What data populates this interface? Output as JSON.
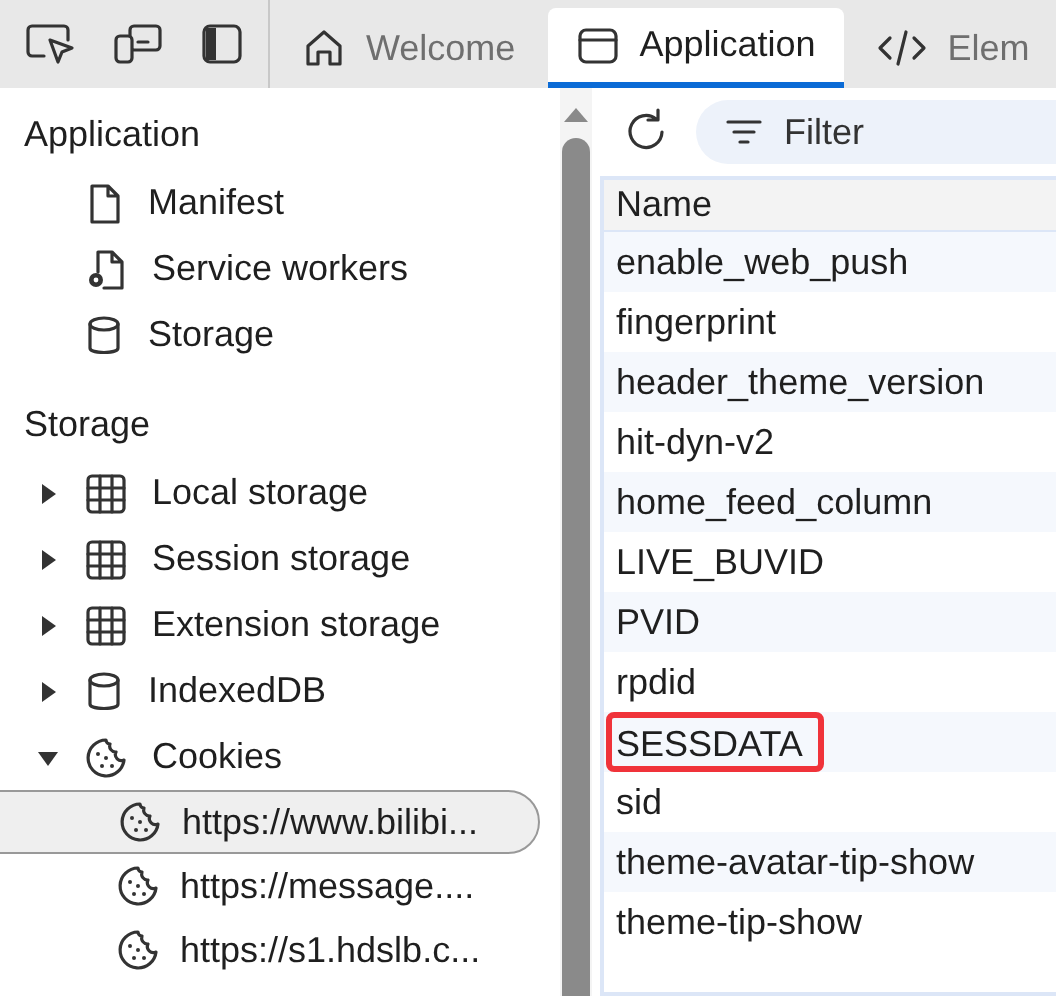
{
  "tabs": [
    {
      "label": "Welcome",
      "kind": "home",
      "selected": false
    },
    {
      "label": "Application",
      "kind": "window",
      "selected": true
    },
    {
      "label": "Elem",
      "kind": "code",
      "selected": false
    }
  ],
  "sidebar": {
    "sections": [
      {
        "title": "Application",
        "items": [
          {
            "label": "Manifest",
            "kind": "file"
          },
          {
            "label": "Service workers",
            "kind": "worker"
          },
          {
            "label": "Storage",
            "kind": "db"
          }
        ]
      },
      {
        "title": "Storage",
        "items": [
          {
            "label": "Local storage",
            "kind": "grid",
            "expanded": false
          },
          {
            "label": "Session storage",
            "kind": "grid",
            "expanded": false
          },
          {
            "label": "Extension storage",
            "kind": "grid",
            "expanded": false
          },
          {
            "label": "IndexedDB",
            "kind": "db",
            "expanded": false
          },
          {
            "label": "Cookies",
            "kind": "cookie",
            "expanded": true,
            "children": [
              {
                "label": "https://www.bilibi...",
                "selected": true
              },
              {
                "label": "https://message....",
                "selected": false
              },
              {
                "label": "https://s1.hdslb.c...",
                "selected": false
              }
            ]
          }
        ]
      }
    ]
  },
  "filter": {
    "placeholder": "Filter"
  },
  "table": {
    "columns": [
      "Name"
    ],
    "rows": [
      {
        "name": "enable_web_push",
        "highlighted": false
      },
      {
        "name": "fingerprint",
        "highlighted": false
      },
      {
        "name": "header_theme_version",
        "highlighted": false
      },
      {
        "name": "hit-dyn-v2",
        "highlighted": false
      },
      {
        "name": "home_feed_column",
        "highlighted": false
      },
      {
        "name": "LIVE_BUVID",
        "highlighted": false
      },
      {
        "name": "PVID",
        "highlighted": false
      },
      {
        "name": "rpdid",
        "highlighted": false
      },
      {
        "name": "SESSDATA",
        "highlighted": true
      },
      {
        "name": "sid",
        "highlighted": false
      },
      {
        "name": "theme-avatar-tip-show",
        "highlighted": false
      },
      {
        "name": "theme-tip-show",
        "highlighted": false
      }
    ]
  }
}
